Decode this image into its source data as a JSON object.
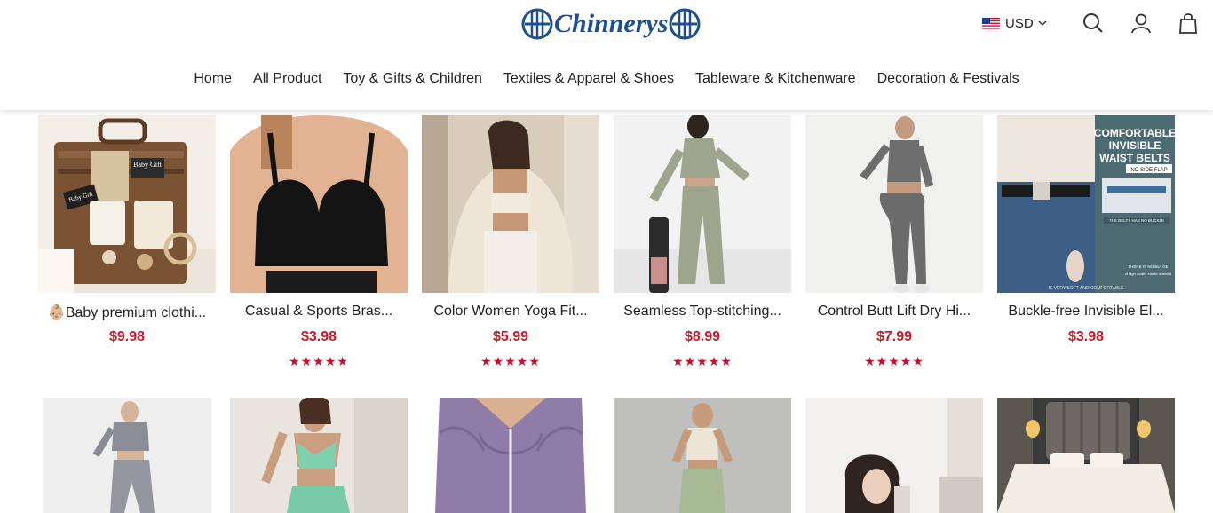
{
  "brand": {
    "name": "Chinnerys",
    "color": "#1e4f8f"
  },
  "header": {
    "currency": "USD",
    "icons": [
      "search-icon",
      "account-icon",
      "cart-icon",
      "chevron-down-icon",
      "us-flag-icon"
    ]
  },
  "nav": {
    "items": [
      "Home",
      "All Product",
      "Toy & Gifts & Children",
      "Textiles & Apparel & Shoes",
      "Tableware & Kitchenware",
      "Decoration & Festivals"
    ]
  },
  "colors": {
    "price": "#d0172a",
    "stars": "#c8102e"
  },
  "products_row1": [
    {
      "title": "👶🏼Baby premium clothi...",
      "price": "$9.98",
      "stars": ""
    },
    {
      "title": "Casual & Sports Bras...",
      "price": "$3.98",
      "stars": "★★★★★"
    },
    {
      "title": "Color Women Yoga Fit...",
      "price": "$5.99",
      "stars": "★★★★★"
    },
    {
      "title": "Seamless Top-stitching...",
      "price": "$8.99",
      "stars": "★★★★★"
    },
    {
      "title": "Control Butt Lift Dry Hi...",
      "price": "$7.99",
      "stars": "★★★★★"
    },
    {
      "title": "Buckle-free Invisible El...",
      "price": "$3.98",
      "stars": ""
    }
  ],
  "belt_ad": {
    "headline1": "COMFORTABLE",
    "headline2": "INVISIBLE",
    "headline3": "WAIST BELTS",
    "tag": "NO SIDE FLAP",
    "caption": "THE BELTS HAS NO BUCKLE",
    "note1": "THERE IS NO BULGE",
    "note2": "of high quality elastic material",
    "footer": "IS VERY SOFT AND COMFORTABLE"
  },
  "gift_box": {
    "tag1": "Baby Gift",
    "tag2": "Baby Gift"
  }
}
